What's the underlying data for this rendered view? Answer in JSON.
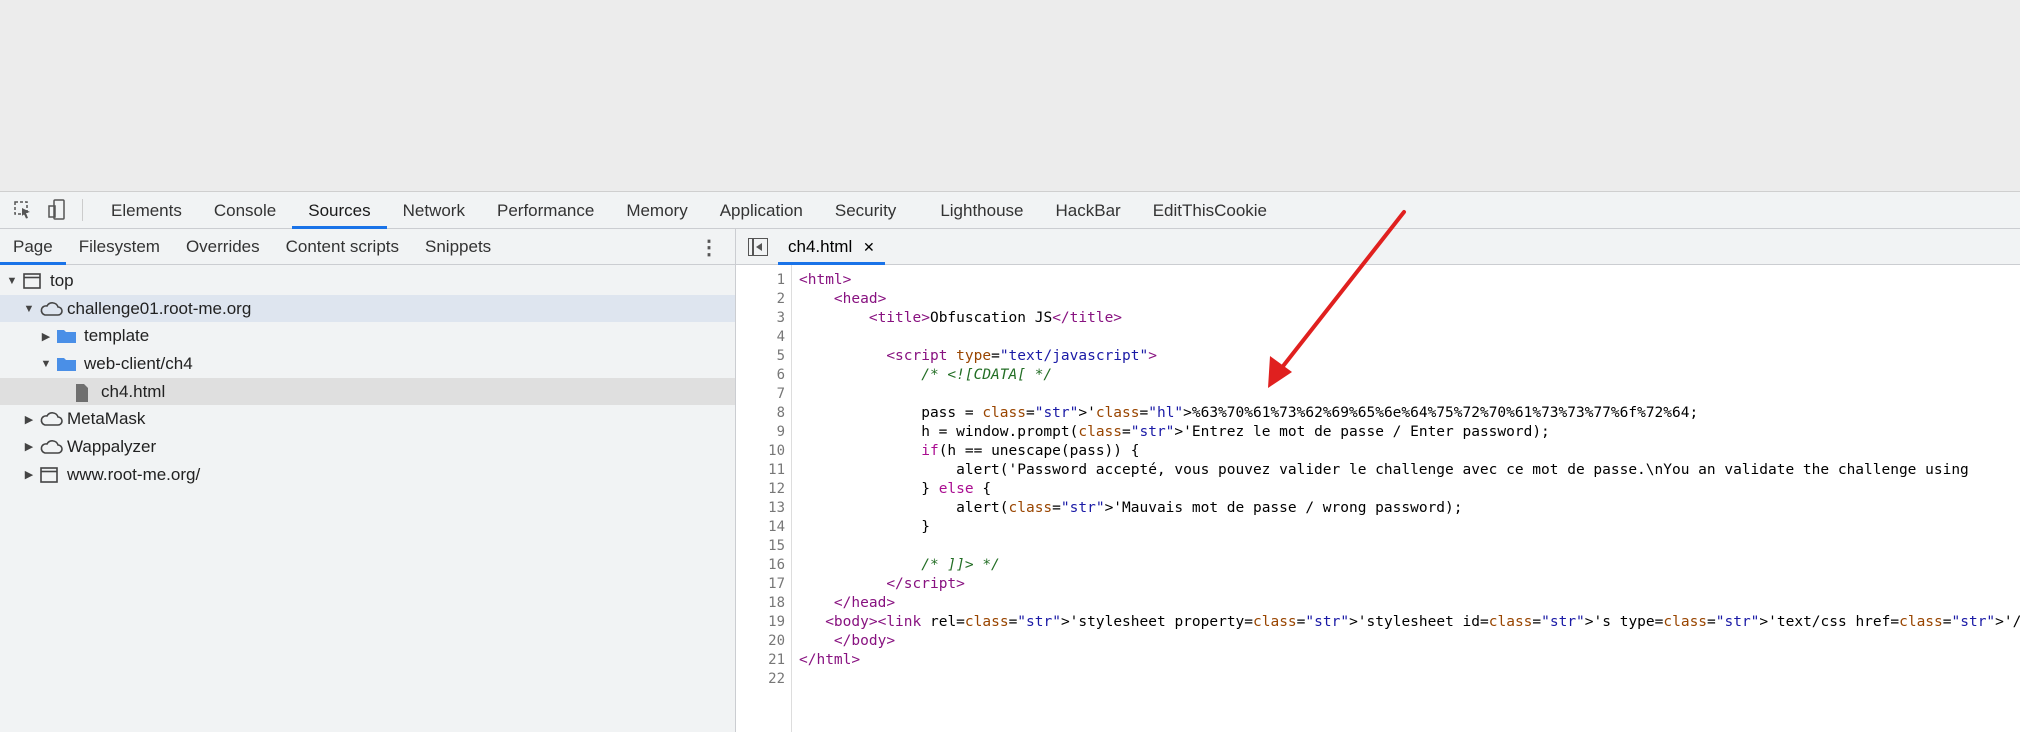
{
  "toolbar": {
    "tabs": [
      "Elements",
      "Console",
      "Sources",
      "Network",
      "Performance",
      "Memory",
      "Application",
      "Security",
      "Lighthouse",
      "HackBar",
      "EditThisCookie"
    ],
    "active": "Sources"
  },
  "navigator": {
    "tabs": [
      "Page",
      "Filesystem",
      "Overrides",
      "Content scripts",
      "Snippets"
    ],
    "active": "Page",
    "tree": [
      {
        "label": "top",
        "icon": "frame-icon",
        "depth": 0,
        "open": true
      },
      {
        "label": "challenge01.root-me.org",
        "icon": "cloud-icon",
        "depth": 1,
        "open": true
      },
      {
        "label": "template",
        "icon": "folder-icon",
        "depth": 2,
        "open": false
      },
      {
        "label": "web-client/ch4",
        "icon": "folder-icon",
        "depth": 2,
        "open": true
      },
      {
        "label": "ch4.html",
        "icon": "file-icon",
        "depth": 3
      },
      {
        "label": "MetaMask",
        "icon": "cloud-icon",
        "depth": 1,
        "open": false
      },
      {
        "label": "Wappalyzer",
        "icon": "cloud-icon",
        "depth": 1,
        "open": false
      },
      {
        "label": "www.root-me.org/",
        "icon": "frame-icon",
        "depth": 1,
        "open": false
      }
    ]
  },
  "editor": {
    "file_tab": "ch4.html",
    "close": "✕",
    "lines": [
      "<html>",
      "    <head>",
      "        <title>Obfuscation JS</title>",
      "",
      "          <script type=\"text/javascript\">",
      "              /* <![CDATA[ */",
      "",
      "              pass = '%63%70%61%73%62%69%65%6e%64%75%72%70%61%73%73%77%6f%72%64';",
      "              h = window.prompt('Entrez le mot de passe / Enter password');",
      "              if(h == unescape(pass)) {",
      "                  alert('Password accepté, vous pouvez valider le challenge avec ce mot de passe.\\nYou an validate the challenge using",
      "              } else {",
      "                  alert('Mauvais mot de passe / wrong password');",
      "              }",
      "",
      "              /* ]]> */",
      "          </script>",
      "    </head>",
      "   <body><link rel='stylesheet' property='stylesheet' id='s' type='text/css' href='/template/s.css' media='all' /><iframe id='iframe' s",
      "    </body>",
      "</html>",
      ""
    ]
  },
  "colors": {
    "accent": "#1a73e8",
    "arrow": "#e0201f",
    "highlight": "#cfe3f7"
  }
}
